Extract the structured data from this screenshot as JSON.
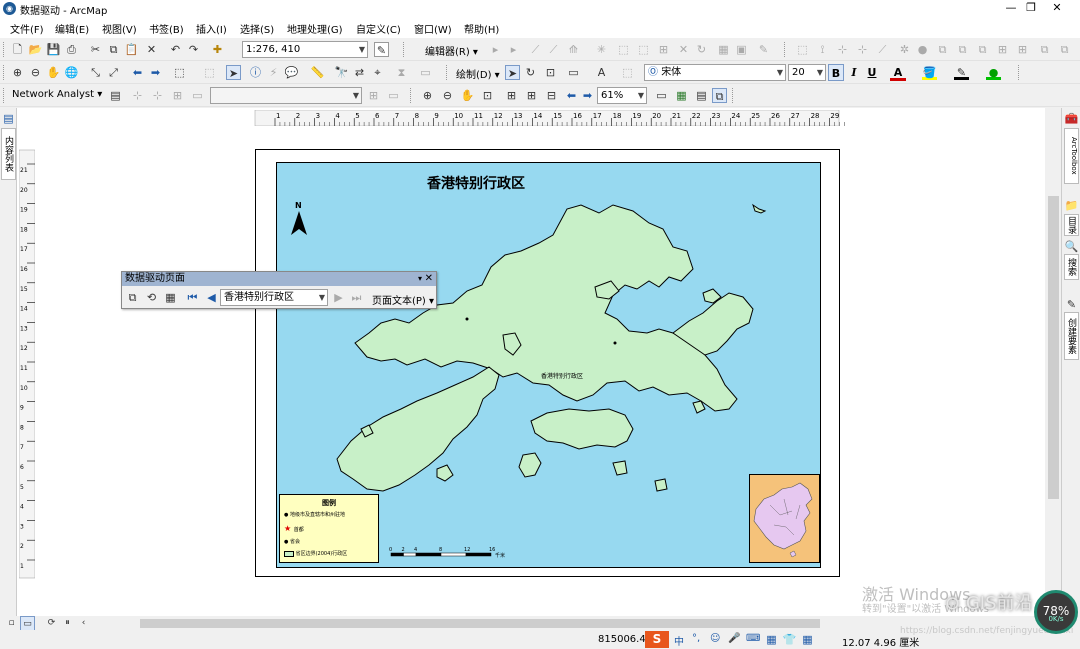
{
  "window": {
    "title": "数据驱动 - ArcMap",
    "controls": [
      "—",
      "❐",
      "✕"
    ]
  },
  "menus": [
    "文件(F)",
    "编辑(E)",
    "视图(V)",
    "书签(B)",
    "插入(I)",
    "选择(S)",
    "地理处理(G)",
    "自定义(C)",
    "窗口(W)",
    "帮助(H)"
  ],
  "toolbar1": {
    "scale_value": "1:276, 410",
    "editor_label": "编辑器(R) ▾"
  },
  "toolbar2": {
    "draw_label": "绘制(D) ▾",
    "font_name": "宋体",
    "font_size": "20",
    "bold": "B",
    "italic": "I",
    "underline": "U",
    "font_color_label": "A"
  },
  "toolbar3": {
    "network_label": "Network Analyst ▾",
    "zoom_value": "61%"
  },
  "left_dock": {
    "tab_label": "内容列表"
  },
  "right_dock": {
    "tabs": [
      "ArcToolbox",
      "目录",
      "搜索",
      "创建要素"
    ]
  },
  "ruler": {
    "h_ticks": [
      "1",
      "2",
      "3",
      "4",
      "5",
      "6",
      "7",
      "8",
      "9",
      "10",
      "11",
      "12",
      "13",
      "14",
      "15",
      "16",
      "17",
      "18",
      "19",
      "20",
      "21",
      "22",
      "23",
      "24",
      "25",
      "26",
      "27",
      "28",
      "29"
    ],
    "v_ticks": [
      "21",
      "20",
      "19",
      "18",
      "17",
      "16",
      "15",
      "14",
      "13",
      "12",
      "11",
      "10",
      "9",
      "8",
      "7",
      "6",
      "5",
      "4",
      "3",
      "2",
      "1"
    ]
  },
  "map": {
    "title": "香港特别行政区",
    "north_label": "N",
    "district_label": "香港特别行政区",
    "colors": {
      "sea": "#97d9f0",
      "land": "#c8f0c8",
      "inset_bg": "#f5c27a",
      "legend_bg": "#ffffc0"
    }
  },
  "legend": {
    "title": "图例",
    "items": [
      "地级市及直辖市和州驻地",
      "首都",
      "省会",
      "省区边界(2004)行政区"
    ]
  },
  "scalebar": {
    "ticks": [
      "0",
      "2",
      "4",
      "8",
      "12",
      "16"
    ],
    "unit": "千米"
  },
  "data_driven_toolbar": {
    "title": "数据驱动页面",
    "page_selector": "香港特别行政区",
    "page_text_label": "页面文本(P) ▾"
  },
  "statusbar": {
    "coordinates": "815006.42",
    "page_coords": "12.07  4.96 厘米",
    "ime_labels": [
      "中",
      "°,",
      "☺",
      "🎤",
      "⌨"
    ]
  },
  "overlays": {
    "activate_line1": "激活 Windows",
    "activate_line2": "转到\"设置\"以激活 Windows",
    "gis_badge": "GIS前沿",
    "url": "https://blog.csdn.net/fenjingyuechenxi",
    "gauge_value": "78%",
    "gauge_sub": "0K/s"
  }
}
